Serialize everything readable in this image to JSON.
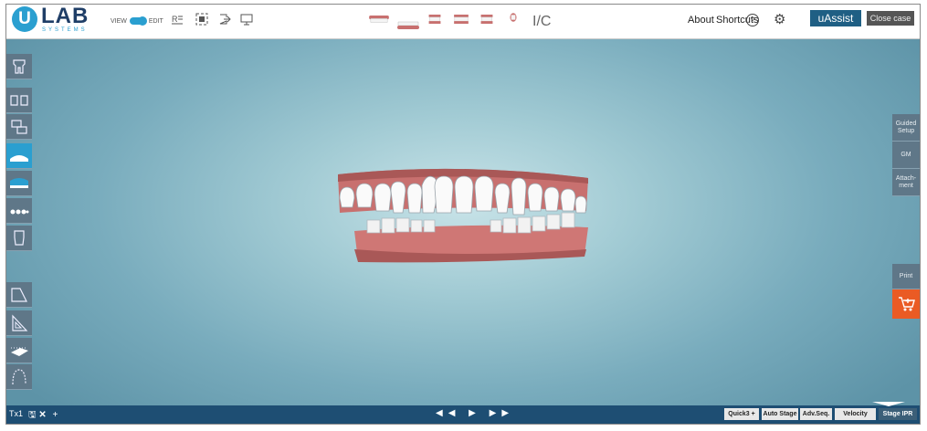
{
  "logo": {
    "mark": "U",
    "brand": "LAB",
    "sub": "SYSTEMS"
  },
  "toolbar": {
    "view_label": "VIEW",
    "edit_label": "EDIT",
    "ic_label": "I/C"
  },
  "topnav": {
    "about": "About",
    "shortcuts": "Shortcuts",
    "uassist": "uAssist",
    "close_case": "Close case"
  },
  "right_panel": {
    "guided_setup": "Guided Setup",
    "gm": "GM",
    "attachment": "Attach-ment",
    "print": "Print"
  },
  "bottom": {
    "tab_name": "Tx1",
    "buttons": [
      "Quick3 +",
      "Auto Stage",
      "Adv.Seq.",
      "Velocity",
      "Stage IPR"
    ]
  },
  "colors": {
    "accent": "#2a9fd0",
    "gum": "#c8706f",
    "cart": "#ea5b24",
    "bottom_bar": "#1e4e73"
  }
}
